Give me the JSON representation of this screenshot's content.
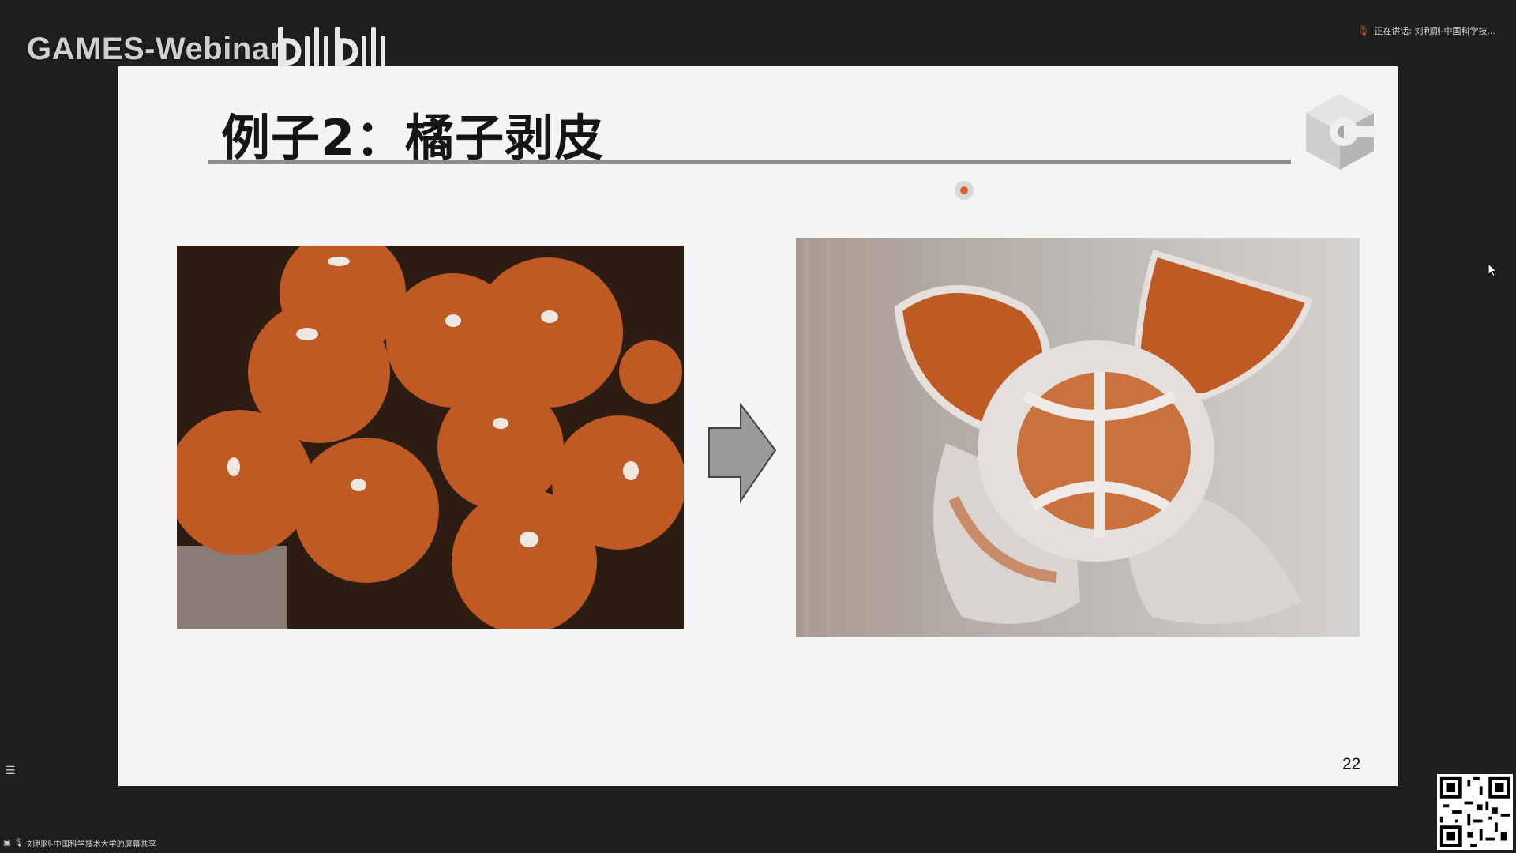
{
  "overlay": {
    "watermark_text": "GAMES-Webinar",
    "bilibili_logo": "bilibili-logo",
    "speaker_status": "正在讲话: 刘利刚-中国科学技...",
    "share_status": "刘利刚-中国科学技术大学的屏幕共享"
  },
  "slide": {
    "title": "例子2：橘子剥皮",
    "page_number": "22",
    "left_image": "oranges-photo",
    "right_image": "peeled-orange-photo",
    "arrow_icon": "right-arrow-icon"
  },
  "colors": {
    "background": "#1f1e1d",
    "slide_bg": "#f4f4f4",
    "orange": "#c05a24",
    "rule_gray": "#8d8d8d"
  }
}
